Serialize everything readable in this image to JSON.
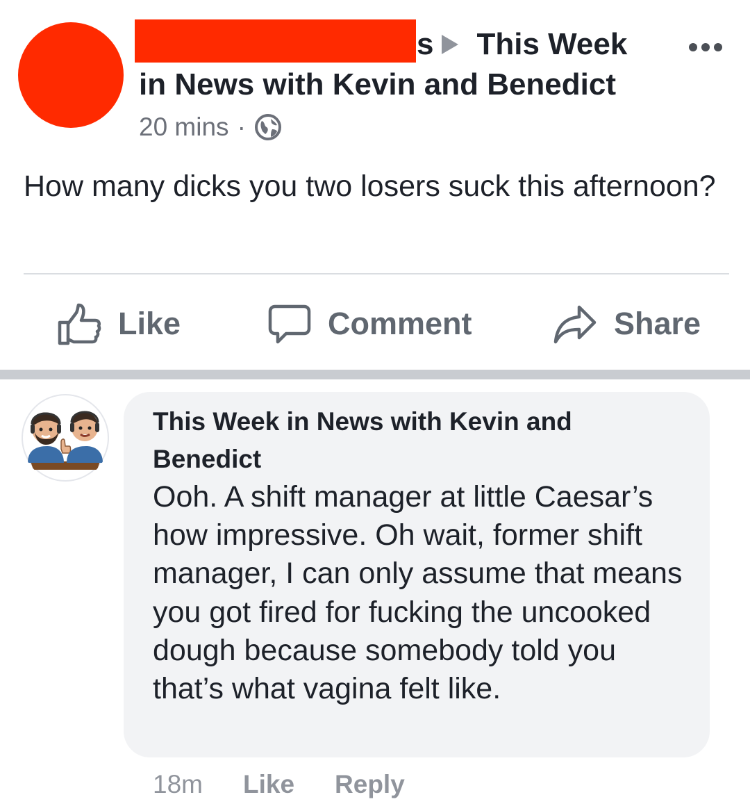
{
  "post": {
    "header_tail": "s",
    "header_part1": "This Week",
    "header_part2": "in News with Kevin and Benedict",
    "timestamp": "20 mins",
    "separator": "·",
    "privacy_icon": "globe-icon",
    "more_icon": "more-options-icon",
    "body": "How many dicks you two losers suck this afternoon?",
    "actions": {
      "like": "Like",
      "comment": "Comment",
      "share": "Share"
    }
  },
  "comment": {
    "author": "This Week in News with Kevin and Benedict",
    "text": "Ooh. A shift manager at little Caesar’s how impressive. Oh wait, former shift manager, I can only assume that means you got fired for fucking the uncooked dough because somebody told you that’s what vagina felt like.",
    "time": "18m",
    "like": "Like",
    "reply": "Reply"
  },
  "colors": {
    "redaction": "#ff2a00",
    "text": "#1d2129",
    "secondary": "#606770",
    "bubble": "#f2f3f5"
  }
}
